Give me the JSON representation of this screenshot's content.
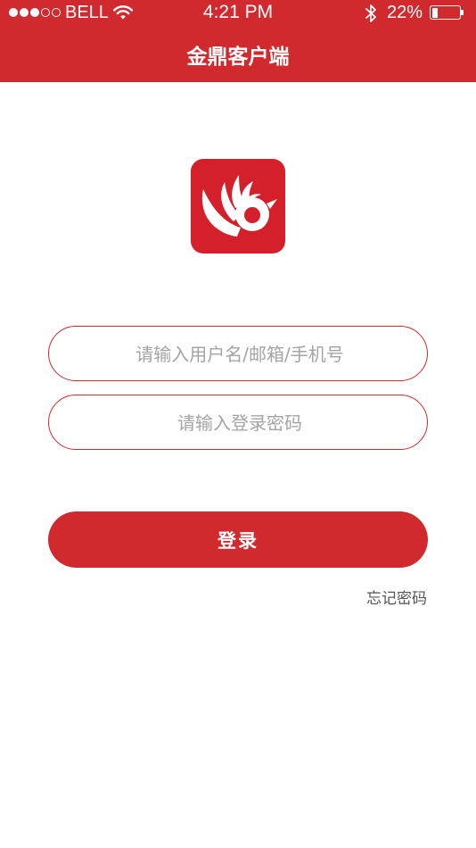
{
  "status_bar": {
    "carrier": "BELL",
    "time": "4:21 PM",
    "battery_percent": "22%",
    "battery_level": 0.22,
    "signal_dots_total": 5,
    "signal_dots_filled": 3,
    "icons": [
      "wifi-icon",
      "bluetooth-icon",
      "battery-icon"
    ]
  },
  "nav": {
    "title": "金鼎客户端"
  },
  "logo": {
    "icon": "app-logo",
    "color": "#d4202a"
  },
  "form": {
    "username_placeholder": "请输入用户名/邮箱/手机号",
    "username_value": "",
    "password_placeholder": "请输入登录密码",
    "password_value": ""
  },
  "actions": {
    "login_label": "登录",
    "forgot_label": "忘记密码"
  },
  "colors": {
    "brand_red": "#d0292e",
    "placeholder_gray": "#a4a4a4",
    "link_gray": "#555555"
  }
}
